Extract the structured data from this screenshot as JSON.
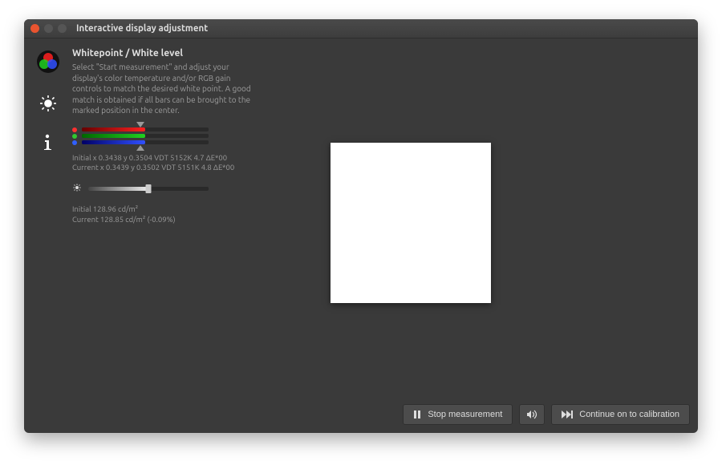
{
  "window": {
    "title": "Interactive display adjustment"
  },
  "section": {
    "title": "Whitepoint / White level",
    "description": "Select \"Start measurement\" and adjust your display's color temperature and/or RGB gain controls to match the desired white point. A good match is obtained if all bars can be brought to the marked position in the center."
  },
  "whitepoint": {
    "initial": "Initial x 0.3438 y 0.3504 VDT 5152K 4.7 ΔE*00",
    "current": "Current x 0.3439 y 0.3502 VDT 5151K 4.8 ΔE*00"
  },
  "whitelevel": {
    "initial": "Initial 128.96 cd/m²",
    "current": "Current 128.85 cd/m² (-0.09%)"
  },
  "footer": {
    "stop": "Stop measurement",
    "continue": "Continue on to calibration"
  }
}
